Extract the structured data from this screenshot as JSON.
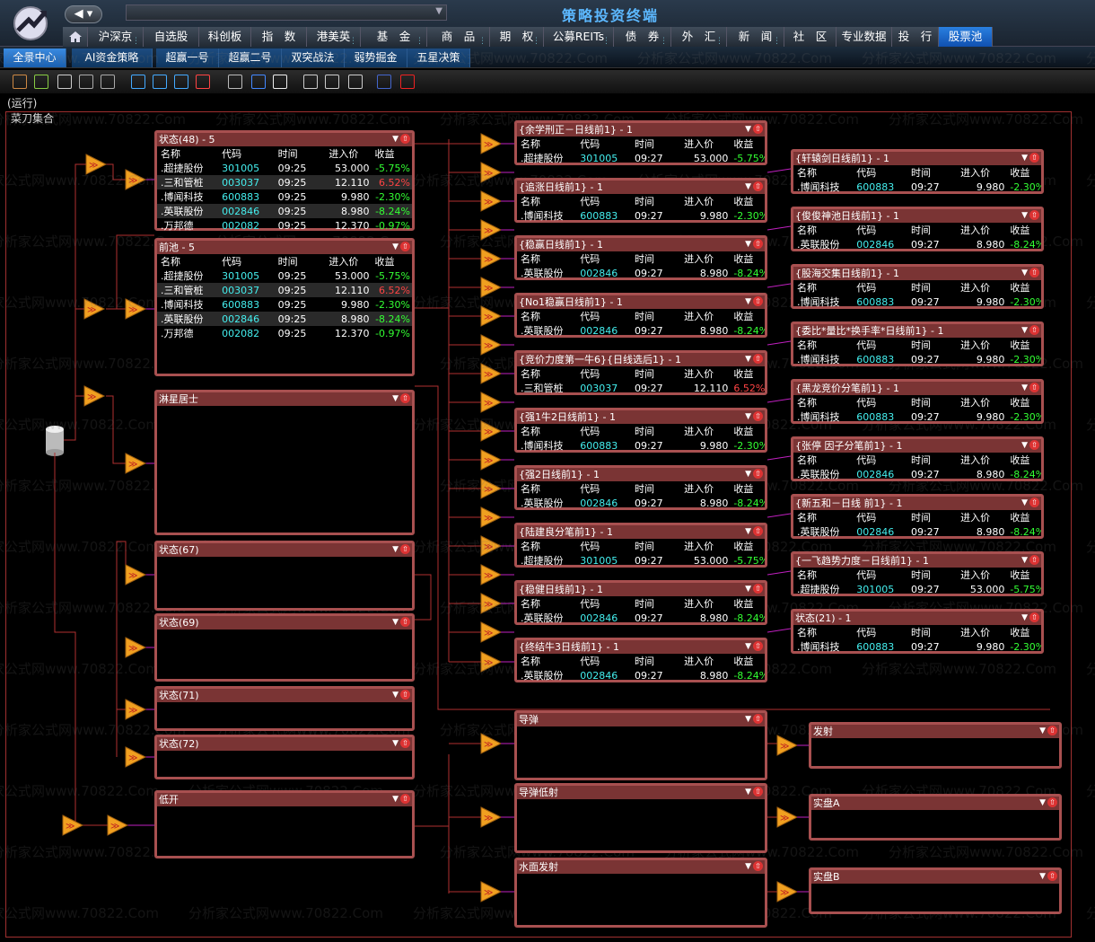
{
  "app": {
    "title": "策略投资终端"
  },
  "nav": {
    "back_label": "◀ ▾"
  },
  "menu": [
    "沪深京",
    "自选股",
    "科创板",
    "指　数",
    "港美英",
    "基　金",
    "商　品",
    "期　权",
    "公募REITs",
    "债　券",
    "外　汇",
    "新　闻",
    "社　区",
    "专业数据",
    "投　行",
    "股票池"
  ],
  "tabs": [
    "全景中心",
    "AI资金策略",
    "超赢一号",
    "超赢二号",
    "双突战法",
    "弱势掘金",
    "五星决策"
  ],
  "run_status": "(运行)",
  "canvas_title": "菜刀集合",
  "columns": [
    "名称",
    "代码",
    "时间",
    "进入价",
    "收益"
  ],
  "stocks": {
    "s1": {
      "name": "超捷股份",
      "code": "301005",
      "price": "53.000",
      "chg": "-5.75%",
      "dir": "down"
    },
    "s2": {
      "name": "三和管桩",
      "code": "003037",
      "price": "12.110",
      "chg": "6.52%",
      "dir": "up"
    },
    "s3": {
      "name": "博闻科技",
      "code": "600883",
      "price": "9.980",
      "chg": "-2.30%",
      "dir": "down"
    },
    "s4": {
      "name": "英联股份",
      "code": "002846",
      "price": "8.980",
      "chg": "-8.24%",
      "dir": "down"
    },
    "s5": {
      "name": "万邦德",
      "code": "002082",
      "price": "12.370",
      "chg": "-0.97%",
      "dir": "down"
    }
  },
  "left_panels": [
    {
      "title": "状态(48) - 5",
      "time": "09:25",
      "rows": [
        "s1",
        "s2",
        "s3",
        "s4",
        "s5"
      ]
    },
    {
      "title": "前池 - 5",
      "time": "09:25",
      "rows": [
        "s1",
        "s2",
        "s3",
        "s4",
        "s5"
      ]
    },
    {
      "title": "淋星居士",
      "rows": []
    },
    {
      "title": "状态(67)",
      "rows": []
    },
    {
      "title": "状态(69)",
      "rows": []
    },
    {
      "title": "状态(71)",
      "rows": []
    },
    {
      "title": "状态(72)",
      "rows": []
    },
    {
      "title": "低开",
      "rows": []
    }
  ],
  "mid_panels": [
    {
      "title": "{余学刑正－日线前1} - 1",
      "time": "09:27",
      "rows": [
        "s1"
      ]
    },
    {
      "title": "{追涨日线前1} - 1",
      "time": "09:27",
      "rows": [
        "s3"
      ]
    },
    {
      "title": "{稳赢日线前1} - 1",
      "time": "09:27",
      "rows": [
        "s4"
      ]
    },
    {
      "title": "{No1稳赢日线前1} - 1",
      "time": "09:27",
      "rows": [
        "s4"
      ]
    },
    {
      "title": "{竞价力度第一牛6}{日线选后1} - 1",
      "time": "09:27",
      "rows": [
        "s2"
      ]
    },
    {
      "title": "{强1牛2日线前1} - 1",
      "time": "09:27",
      "rows": [
        "s3"
      ]
    },
    {
      "title": "{强2日线前1} - 1",
      "time": "09:27",
      "rows": [
        "s4"
      ]
    },
    {
      "title": "{陆建良分笔前1} - 1",
      "time": "09:27",
      "rows": [
        "s1"
      ]
    },
    {
      "title": "{稳健日线前1} - 1",
      "time": "09:27",
      "rows": [
        "s4"
      ]
    },
    {
      "title": "{终结牛3日线前1} - 1",
      "time": "09:27",
      "rows": [
        "s4"
      ]
    },
    {
      "title": "导弹",
      "rows": []
    },
    {
      "title": "导弹低射",
      "rows": []
    },
    {
      "title": "水面发射",
      "rows": []
    }
  ],
  "right_panels": [
    {
      "title": "{轩辕剑日线前1} - 1",
      "time": "09:27",
      "rows": [
        "s3"
      ]
    },
    {
      "title": "{俊俊神池日线前1} - 1",
      "time": "09:27",
      "rows": [
        "s4"
      ]
    },
    {
      "title": "{股海交集日线前1} - 1",
      "time": "09:27",
      "rows": [
        "s3"
      ]
    },
    {
      "title": "{委比*量比*换手率*日线前1} - 1",
      "time": "09:27",
      "rows": [
        "s3"
      ]
    },
    {
      "title": "{黑龙竞价分笔前1} - 1",
      "time": "09:27",
      "rows": [
        "s3"
      ]
    },
    {
      "title": "{张停 因子分笔前1} - 1",
      "time": "09:27",
      "rows": [
        "s4"
      ]
    },
    {
      "title": "{新五和－日线 前1} - 1",
      "time": "09:27",
      "rows": [
        "s4"
      ]
    },
    {
      "title": "{一飞趋势力度－日线前1} - 1",
      "time": "09:27",
      "rows": [
        "s1"
      ]
    },
    {
      "title": "状态(21) - 1",
      "time": "09:27",
      "rows": [
        "s3"
      ]
    },
    {
      "title": "发射",
      "rows": []
    },
    {
      "title": "实盘A",
      "rows": []
    },
    {
      "title": "实盘B",
      "rows": []
    }
  ],
  "watermark": "分析家公式网www.70822.Com",
  "colors": {
    "accent": "#a85050",
    "header": "#7a3434",
    "down": "#33ff33",
    "up": "#ff4444",
    "code": "#44eeee",
    "title": "#5cb8ff"
  }
}
